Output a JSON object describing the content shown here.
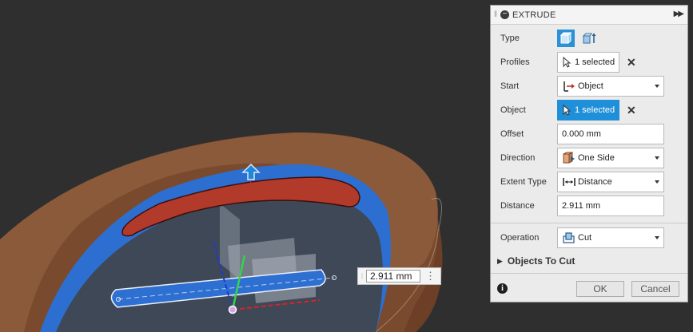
{
  "viewport": {
    "dimension_value": "2.911 mm",
    "menu_glyph": "⋮"
  },
  "panel": {
    "title": "EXTRUDE",
    "rows": {
      "type": {
        "label": "Type"
      },
      "profiles": {
        "label": "Profiles",
        "value": "1 selected"
      },
      "start": {
        "label": "Start",
        "value": "Object"
      },
      "object": {
        "label": "Object",
        "value": "1 selected"
      },
      "offset": {
        "label": "Offset",
        "value": "0.000 mm"
      },
      "direction": {
        "label": "Direction",
        "value": "One Side"
      },
      "extent_type": {
        "label": "Extent Type",
        "value": "Distance"
      },
      "distance": {
        "label": "Distance",
        "value": "2.911 mm"
      },
      "operation": {
        "label": "Operation",
        "value": "Cut"
      }
    },
    "section": {
      "label": "Objects To Cut"
    },
    "footer": {
      "ok_label": "OK",
      "cancel_label": "Cancel"
    }
  },
  "colors": {
    "accent": "#1e8fd8",
    "body_brown": "#8a5a3a",
    "selected_face_blue": "#2d6fd0",
    "profile_red": "#b23a2a",
    "background": "#2f2f2f"
  }
}
